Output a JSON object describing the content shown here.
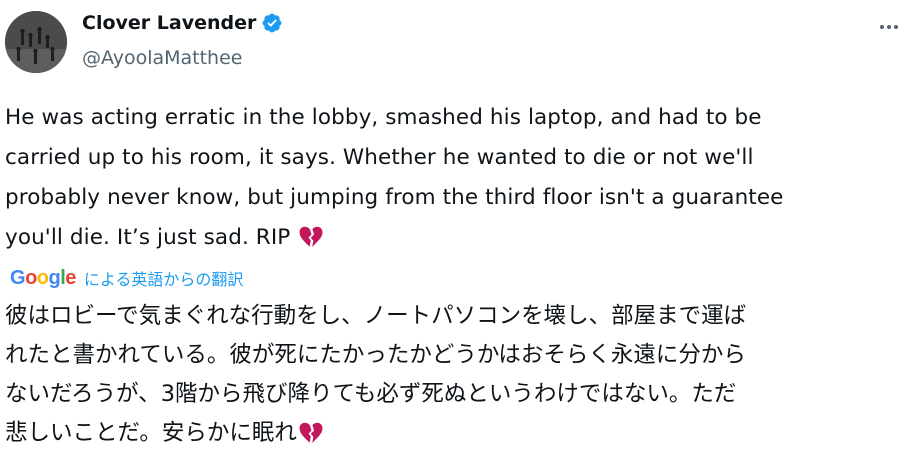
{
  "author": {
    "display_name": "Clover Lavender",
    "handle": "@AyoolaMatthee",
    "verified_icon": "verified-badge-icon"
  },
  "menu": {
    "icon": "more-options-icon"
  },
  "tweet": {
    "lines": [
      "He was acting erratic in the lobby, smashed his laptop, and had to be",
      "carried up to his room, it says. Whether he wanted to die or not we'll",
      "probably never know, but jumping from the third floor isn't a guarantee",
      "you'll die. It’s just sad. RIP"
    ],
    "emoji": "broken-heart-icon"
  },
  "translation": {
    "google_letters": [
      "G",
      "o",
      "o",
      "g",
      "l",
      "e"
    ],
    "google_colors": [
      "#4285F4",
      "#EA4335",
      "#FBBC05",
      "#4285F4",
      "#34A853",
      "#EA4335"
    ],
    "label": "による英語からの翻訳",
    "lines": [
      "彼はロビーで気まぐれな行動をし、ノートパソコンを壊し、部屋まで運ば",
      "れたと書かれている。彼が死にたかったかどうかはおそらく永遠に分から",
      "ないだろうが、3階から飛び降りても必ず死ぬというわけではない。ただ",
      "悲しいことだ。安らかに眠れ"
    ]
  },
  "colors": {
    "text": "#0f1419",
    "secondary": "#536471",
    "accent": "#1d9bf0",
    "heart": "#c2185b"
  }
}
